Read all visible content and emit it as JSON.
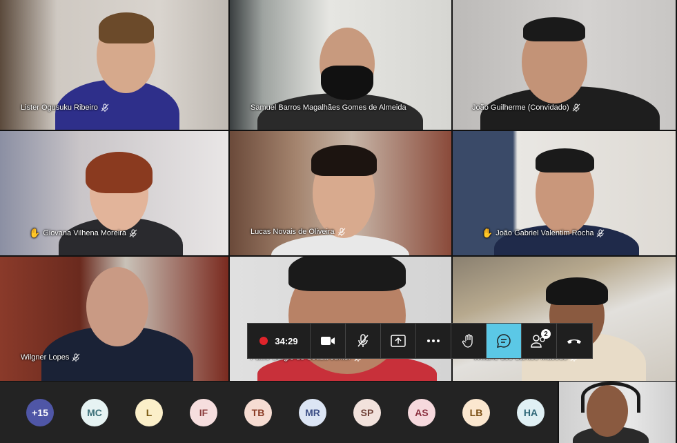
{
  "participants": [
    {
      "name": "Lister Ogusuku Ribeiro",
      "hand": false
    },
    {
      "name": "Samuel Barros Magalhães Gomes de Almeida",
      "hand": false
    },
    {
      "name": "João Guilherme (Convidado)",
      "hand": false
    },
    {
      "name": "Giovana Vilhena Moreira",
      "hand": true
    },
    {
      "name": "Lucas Novais de Oliveira",
      "hand": false
    },
    {
      "name": "João Gabriel Valentim Rocha",
      "hand": true
    },
    {
      "name": "Wilgner Lopes",
      "hand": false
    },
    {
      "name": "Paulo Sergio de Souza Junior",
      "hand": false
    },
    {
      "name": "Willane dos Santos Macedo",
      "hand": false
    }
  ],
  "toolbar": {
    "timer": "34:29",
    "participants_badge": "2",
    "icons": [
      "record-icon",
      "video-camera-icon",
      "mic-off-icon",
      "share-screen-icon",
      "more-icon",
      "raise-hand-icon",
      "chat-icon",
      "participants-icon",
      "hang-up-icon"
    ]
  },
  "overflow": {
    "more_count": "+15",
    "avatars": [
      {
        "initials": "MC",
        "bg": "#e6f3f3",
        "fg": "#3b6f78"
      },
      {
        "initials": "L",
        "bg": "#fbefc9",
        "fg": "#7a5a12"
      },
      {
        "initials": "IF",
        "bg": "#f6dede",
        "fg": "#8a3b3b"
      },
      {
        "initials": "TB",
        "bg": "#f6dcd2",
        "fg": "#8a3b25"
      },
      {
        "initials": "MR",
        "bg": "#dce5f4",
        "fg": "#3d4f86"
      },
      {
        "initials": "SP",
        "bg": "#f2e2dc",
        "fg": "#6f3f35"
      },
      {
        "initials": "AS",
        "bg": "#f6d9dd",
        "fg": "#8a2f3e"
      },
      {
        "initials": "LB",
        "bg": "#fbe7cf",
        "fg": "#7a4e12"
      },
      {
        "initials": "HA",
        "bg": "#e0f0f4",
        "fg": "#2f6778"
      }
    ],
    "more_bg": "#4f56a6"
  }
}
